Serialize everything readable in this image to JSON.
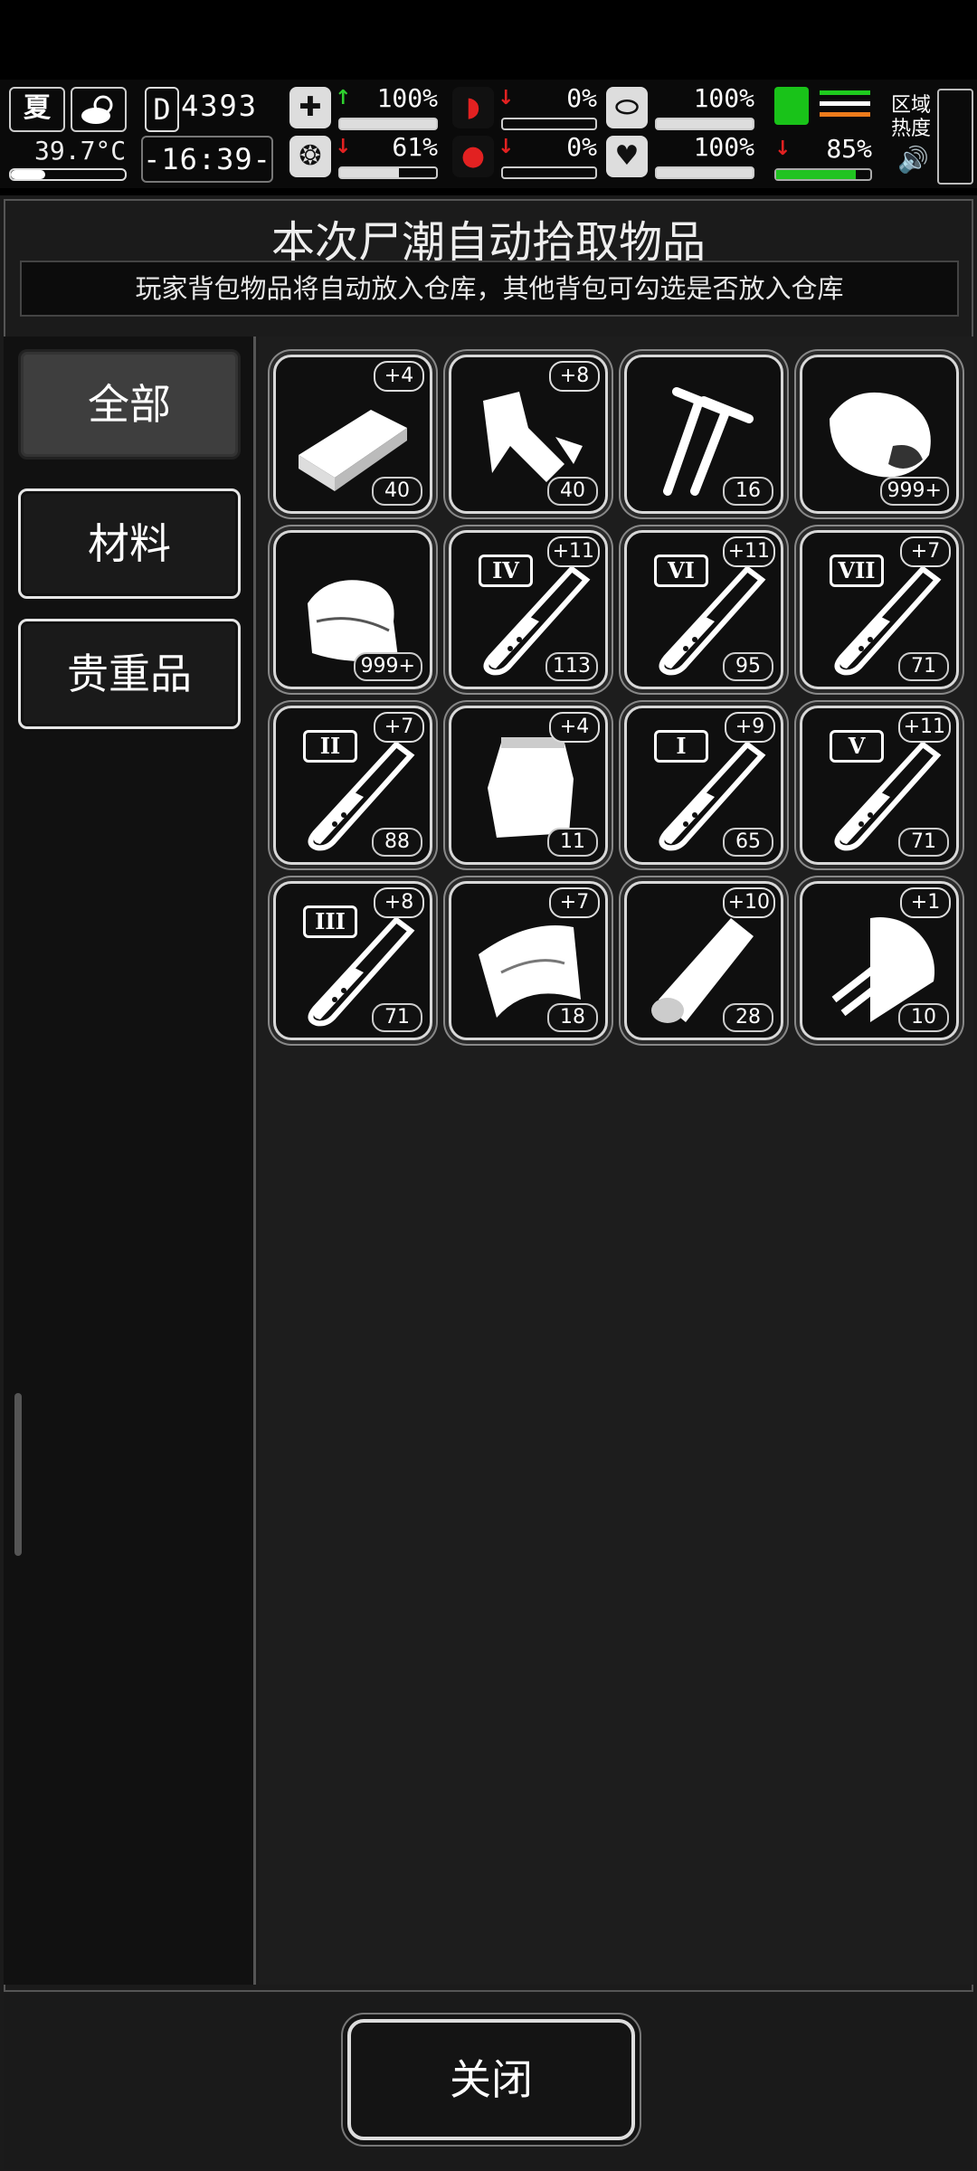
{
  "hud": {
    "season": "夏",
    "weather_icon": "partly-cloudy-icon",
    "temperature": "39.7°C",
    "day": "D",
    "score": "4393",
    "clock": "-16:39-",
    "thermometer_fill": 0.3,
    "stats": [
      {
        "name": "health",
        "icon": "medkit-icon",
        "arrow": "↑",
        "arrow_color": "#2fd12f",
        "value": "100%",
        "level": 1.0
      },
      {
        "name": "hunger",
        "icon": "stomach-icon",
        "arrow": "↓",
        "arrow_color": "#e22121",
        "value": "0%",
        "level": 0.0
      },
      {
        "name": "medicine",
        "icon": "pill-icon",
        "arrow": "",
        "arrow_color": "",
        "value": "100%",
        "level": 1.0
      },
      {
        "name": "sanity",
        "icon": "brain-icon",
        "arrow": "↓",
        "arrow_color": "#e22121",
        "value": "61%",
        "level": 0.61
      },
      {
        "name": "blood",
        "icon": "blood-drop-icon",
        "arrow": "↓",
        "arrow_color": "#e22121",
        "value": "0%",
        "level": 0.0
      },
      {
        "name": "mood",
        "icon": "heart-icon",
        "arrow": "",
        "arrow_color": "",
        "value": "100%",
        "level": 1.0
      }
    ],
    "stamina": {
      "arrow": "↓",
      "value": "85%",
      "level": 0.85
    },
    "area_label_1": "区域",
    "area_label_2": "热度",
    "speaker_icon": "speaker-icon"
  },
  "panel": {
    "title": "本次尸潮自动拾取物品",
    "subtitle": "玩家背包物品将自动放入仓库，其他背包可勾选是否放入仓库"
  },
  "tabs": [
    {
      "label": "全部",
      "active": true
    },
    {
      "label": "材料",
      "active": false
    },
    {
      "label": "贵重品",
      "active": false
    }
  ],
  "items": [
    {
      "icon": "wood-plank-icon",
      "count": "40",
      "bonus": "+4",
      "roman": ""
    },
    {
      "icon": "scrap-metal-icon",
      "count": "40",
      "bonus": "+8",
      "roman": ""
    },
    {
      "icon": "nails-icon",
      "count": "16",
      "bonus": "",
      "roman": ""
    },
    {
      "icon": "meat-icon",
      "count": "999+",
      "bonus": "",
      "roman": ""
    },
    {
      "icon": "cloth-icon",
      "count": "999+",
      "bonus": "",
      "roman": ""
    },
    {
      "icon": "test-tube-icon",
      "count": "113",
      "bonus": "+11",
      "roman": "IV"
    },
    {
      "icon": "test-tube-icon",
      "count": "95",
      "bonus": "+11",
      "roman": "VI"
    },
    {
      "icon": "test-tube-icon",
      "count": "71",
      "bonus": "+7",
      "roman": "VII"
    },
    {
      "icon": "test-tube-icon",
      "count": "88",
      "bonus": "+7",
      "roman": "II"
    },
    {
      "icon": "pouch-icon",
      "count": "11",
      "bonus": "+4",
      "roman": ""
    },
    {
      "icon": "test-tube-icon",
      "count": "65",
      "bonus": "+9",
      "roman": "I"
    },
    {
      "icon": "test-tube-icon",
      "count": "71",
      "bonus": "+11",
      "roman": "V"
    },
    {
      "icon": "test-tube-icon",
      "count": "71",
      "bonus": "+8",
      "roman": "III"
    },
    {
      "icon": "leather-icon",
      "count": "18",
      "bonus": "+7",
      "roman": ""
    },
    {
      "icon": "log-icon",
      "count": "28",
      "bonus": "+10",
      "roman": ""
    },
    {
      "icon": "wood-chips-icon",
      "count": "10",
      "bonus": "+1",
      "roman": ""
    }
  ],
  "close_label": "关闭"
}
